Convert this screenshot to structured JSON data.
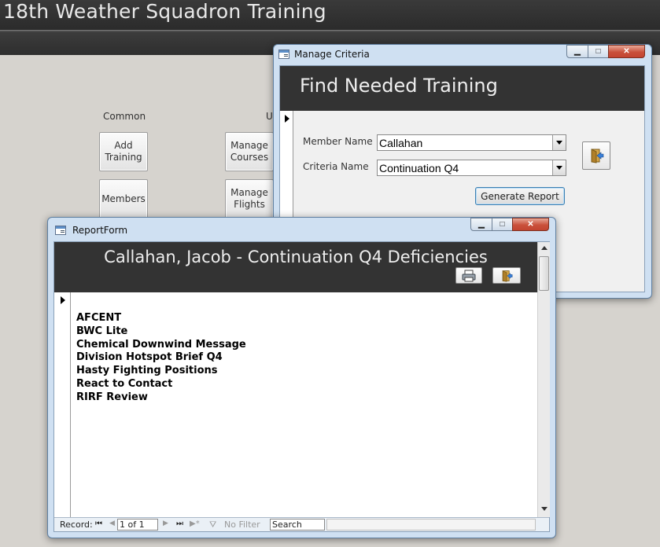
{
  "app": {
    "title": "18th Weather Squadron Training"
  },
  "nav": {
    "group_common": "Common",
    "group_u": "U",
    "add_training": "Add\nTraining",
    "members": "Members",
    "manage_courses": "Manage\nCourses",
    "manage_flights": "Manage\nFlights"
  },
  "manage_criteria": {
    "window_title": "Manage Criteria",
    "header": "Find Needed Training",
    "member_label": "Member Name",
    "member_value": "Callahan",
    "criteria_label": "Criteria Name",
    "criteria_value": "Continuation Q4",
    "generate_button": "Generate Report",
    "exit_icon": "exit-door-icon"
  },
  "report_form": {
    "window_title": "ReportForm",
    "header": "Callahan, Jacob - Continuation Q4 Deficiencies",
    "print_icon": "printer-icon",
    "exit_icon": "exit-door-icon",
    "items": [
      "AFCENT",
      "BWC Lite",
      "Chemical Downwind Message",
      "Division Hotspot Brief Q4",
      "Hasty Fighting Positions",
      "React to Contact",
      "RIRF Review"
    ],
    "record_nav": {
      "record_label": "Record:",
      "position": "1 of 1",
      "filter_label": "No Filter",
      "search_placeholder": "Search"
    }
  },
  "caption_buttons": {
    "minimize": "▁",
    "maximize": "□",
    "close": "✕"
  }
}
